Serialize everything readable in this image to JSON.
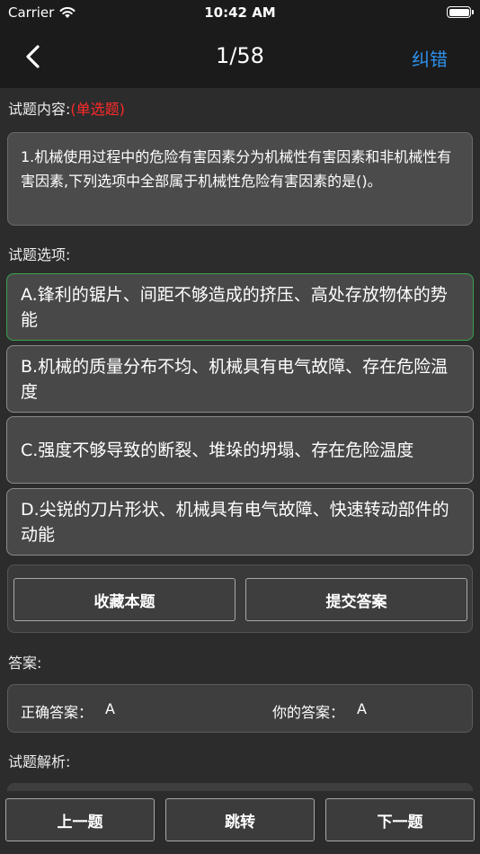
{
  "status_bar": {
    "carrier": "Carrier",
    "time": "10:42 AM"
  },
  "nav": {
    "title": "1/58",
    "action_label": "纠错"
  },
  "question": {
    "section_label": "试题内容:",
    "type_label": "(单选题)",
    "text": "1.机械使用过程中的危险有害因素分为机械性有害因素和非机械性有害因素,下列选项中全部属于机械性危险有害因素的是()。"
  },
  "options": {
    "section_label": "试题选项:",
    "items": [
      {
        "text": "A.锋利的锯片、间距不够造成的挤压、高处存放物体的势能"
      },
      {
        "text": "B.机械的质量分布不均、机械具有电气故障、存在危险温度"
      },
      {
        "text": "C.强度不够导致的断裂、堆垛的坍塌、存在危险温度"
      },
      {
        "text": "D.尖锐的刀片形状、机械具有电气故障、快速转动部件的动能"
      }
    ]
  },
  "actions": {
    "favorite_label": "收藏本题",
    "submit_label": "提交答案"
  },
  "answer": {
    "section_label": "答案:",
    "correct_label": "正确答案：",
    "correct_value": "A",
    "yours_label": "你的答案：",
    "yours_value": "A"
  },
  "analysis": {
    "section_label": "试题解析:"
  },
  "bottom_nav": {
    "prev_label": "上一题",
    "jump_label": "跳转",
    "next_label": "下一题"
  },
  "colors": {
    "accent": "#2e90ea",
    "type_red": "#ff2a2a",
    "selected_green": "#3aa24f"
  }
}
